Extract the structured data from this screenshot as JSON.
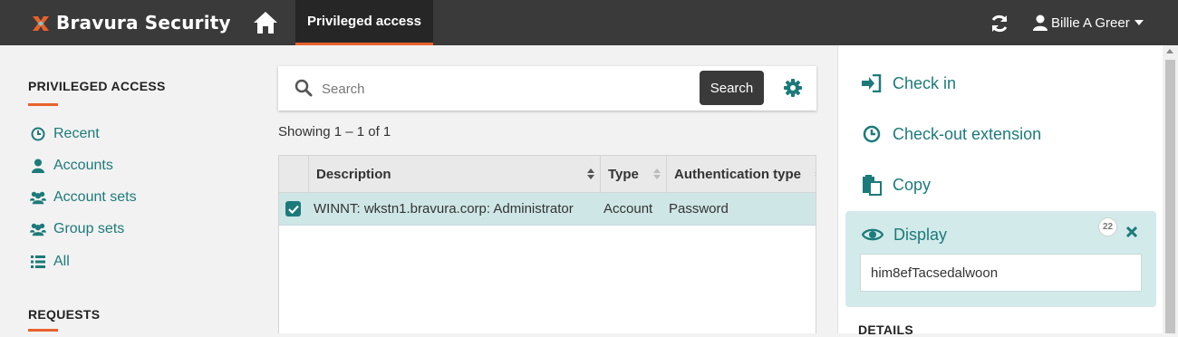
{
  "app": {
    "brand": "Bravura Security",
    "nav_tab": "Privileged access",
    "user_name": "Billie A Greer"
  },
  "sidebar": {
    "privileged_title": "PRIVILEGED ACCESS",
    "items": [
      {
        "label": "Recent",
        "icon": "clock-icon"
      },
      {
        "label": "Accounts",
        "icon": "user-icon"
      },
      {
        "label": "Account sets",
        "icon": "users-icon"
      },
      {
        "label": "Group sets",
        "icon": "users-icon"
      },
      {
        "label": "All",
        "icon": "list-icon"
      }
    ],
    "requests_title": "REQUESTS"
  },
  "search": {
    "placeholder": "Search",
    "value": "",
    "button": "Search"
  },
  "results": {
    "showing": "Showing 1 – 1 of 1",
    "columns": [
      "Description",
      "Type",
      "Authentication type"
    ],
    "rows": [
      {
        "selected": true,
        "description": "WINNT: wkstn1.bravura.corp: Administrator",
        "type": "Account",
        "auth_type": "Password"
      }
    ]
  },
  "actions": {
    "check_in": "Check in",
    "extension": "Check-out extension",
    "copy": "Copy",
    "display": "Display",
    "timer": "22",
    "password": "him8efTacsedalwoon",
    "details": "DETAILS"
  },
  "colors": {
    "accent": "#e8612c",
    "teal": "#1d7a7a",
    "topbar": "#3a3a3a",
    "selected_row": "#cfe6e6"
  }
}
